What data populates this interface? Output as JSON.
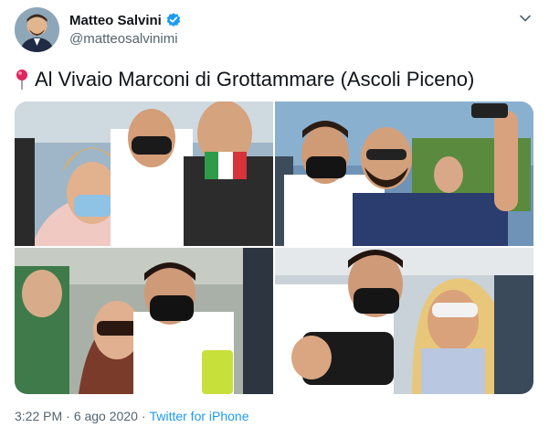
{
  "author": {
    "name": "Matteo Salvini",
    "handle": "@matteosalvinimi",
    "verified_icon": "verified-badge-icon"
  },
  "tweet": {
    "pin_icon": "round-pushpin-icon",
    "text": "Al Vivaio Marconi di Grottammare (Ascoli Piceno)"
  },
  "menu_icon": "chevron-down-icon",
  "meta": {
    "time": "3:22 PM",
    "separator": "·",
    "date": "6 ago 2020",
    "source": "Twitter for iPhone"
  },
  "colors": {
    "link": "#1d9bf0",
    "secondary_text": "#536471",
    "verified": "#1d9bf0",
    "pin": "#e0245e"
  }
}
